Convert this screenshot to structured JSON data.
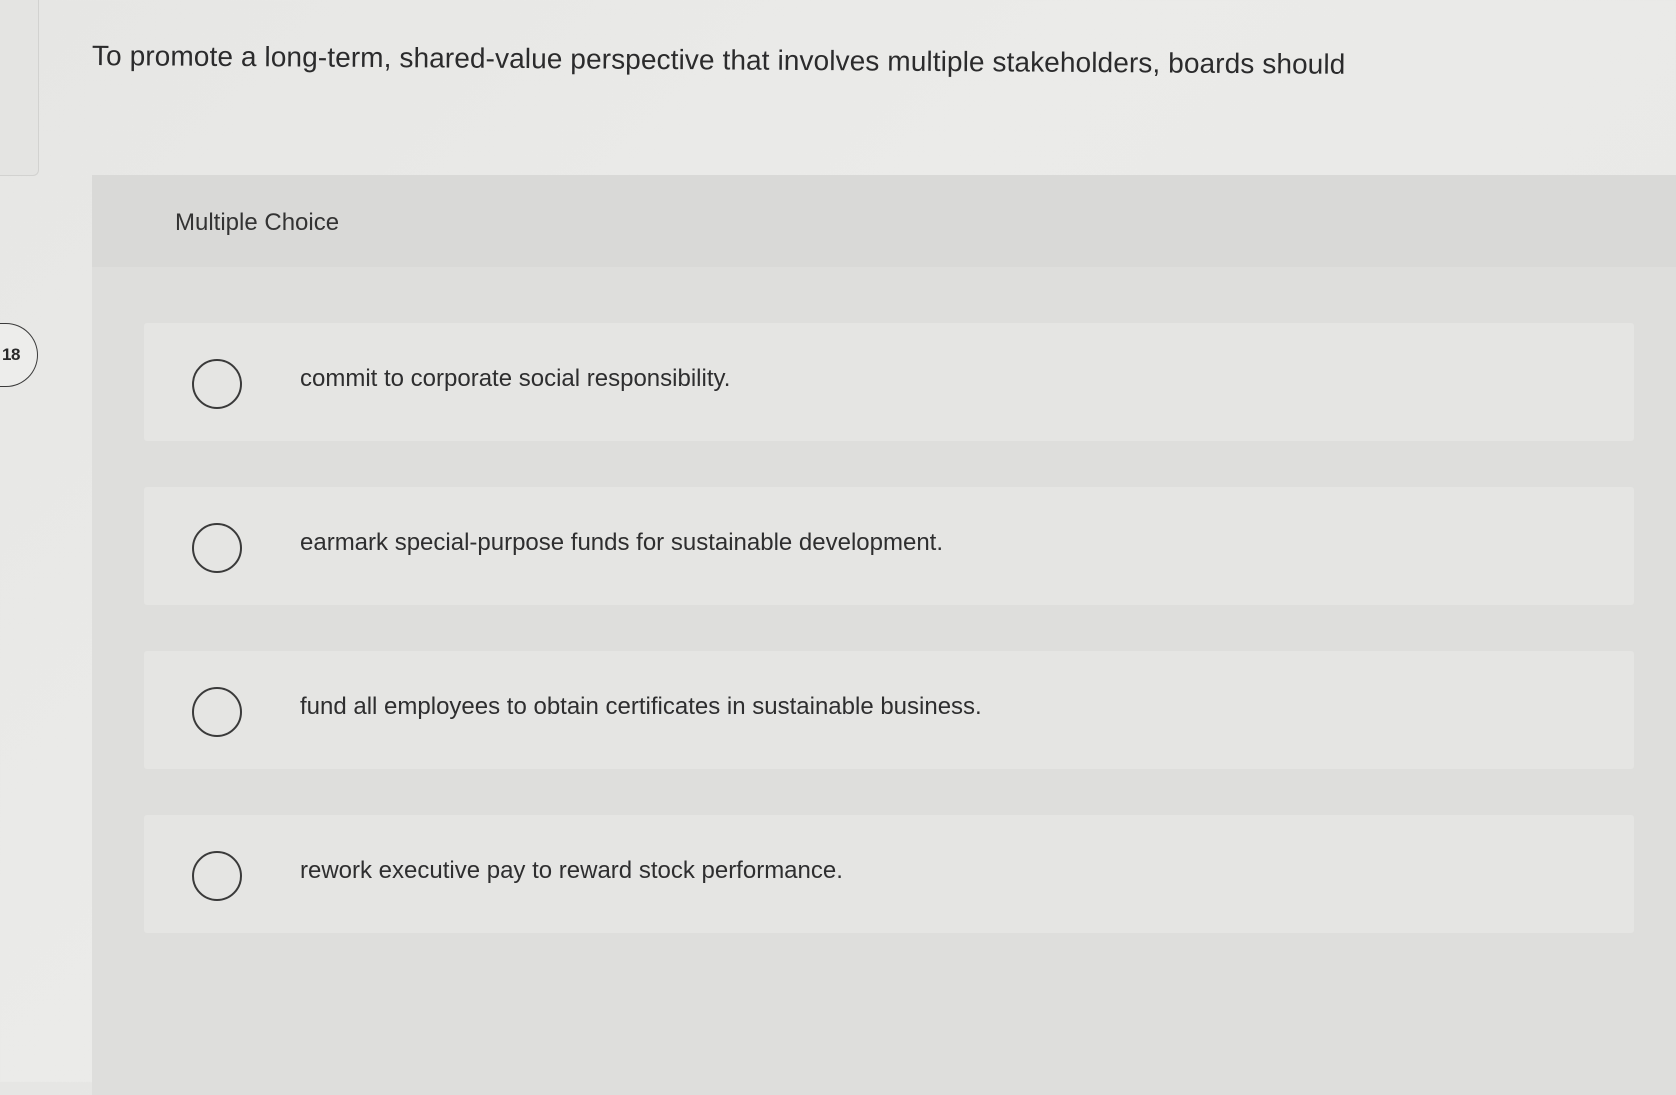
{
  "question": {
    "number": "18",
    "text": "To promote a long-term, shared-value perspective that involves multiple stakeholders, boards should"
  },
  "multiple_choice": {
    "label": "Multiple Choice",
    "options": [
      {
        "text": "commit to corporate social responsibility."
      },
      {
        "text": "earmark special-purpose funds for sustainable development."
      },
      {
        "text": "fund all employees to obtain certificates in sustainable business."
      },
      {
        "text": "rework executive pay to reward stock performance."
      }
    ]
  }
}
